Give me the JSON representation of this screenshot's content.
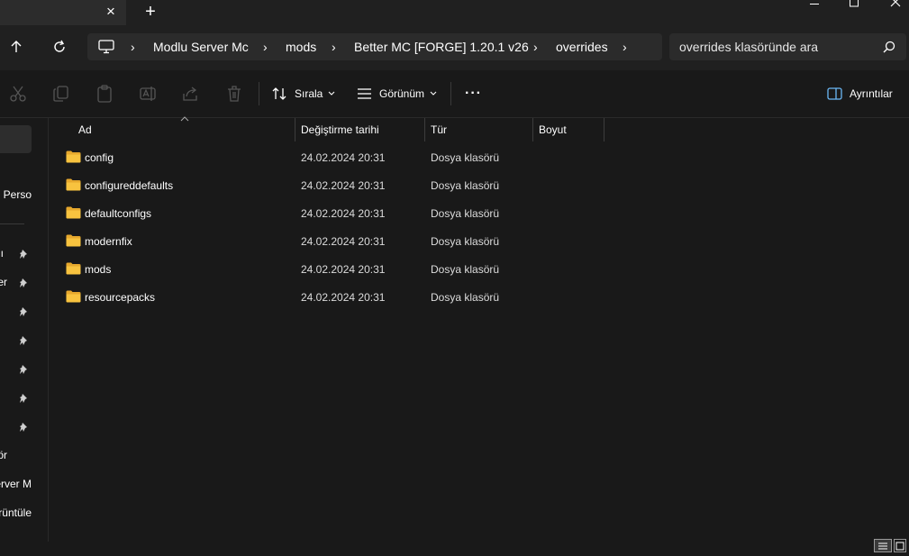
{
  "tab": {
    "close_glyph": "×",
    "new_glyph": "+"
  },
  "address": {
    "crumbs": [
      "Modlu Server Mc",
      "mods",
      "Better MC [FORGE] 1.20.1 v26",
      "overrides"
    ],
    "separator": "›"
  },
  "search": {
    "placeholder": "overrides klasöründe ara"
  },
  "toolbar": {
    "sort_label": "Sırala",
    "view_label": "Görünüm",
    "more_glyph": "···",
    "details_label": "Ayrıntılar"
  },
  "sidebar": {
    "items": [
      "- Perso",
      "ı",
      "er",
      "ör",
      "erver M",
      "rüntüle"
    ]
  },
  "columns": {
    "name": "Ad",
    "modified": "Değiştirme tarihi",
    "type": "Tür",
    "size": "Boyut"
  },
  "files": [
    {
      "name": "config",
      "modified": "24.02.2024 20:31",
      "type": "Dosya klasörü"
    },
    {
      "name": "configureddefaults",
      "modified": "24.02.2024 20:31",
      "type": "Dosya klasörü"
    },
    {
      "name": "defaultconfigs",
      "modified": "24.02.2024 20:31",
      "type": "Dosya klasörü"
    },
    {
      "name": "modernfix",
      "modified": "24.02.2024 20:31",
      "type": "Dosya klasörü"
    },
    {
      "name": "mods",
      "modified": "24.02.2024 20:31",
      "type": "Dosya klasörü"
    },
    {
      "name": "resourcepacks",
      "modified": "24.02.2024 20:31",
      "type": "Dosya klasörü"
    }
  ],
  "icons": {
    "folder_color": "#f8c33f",
    "folder_back": "#e6a82d",
    "pin_color": "#cfcfcf"
  }
}
